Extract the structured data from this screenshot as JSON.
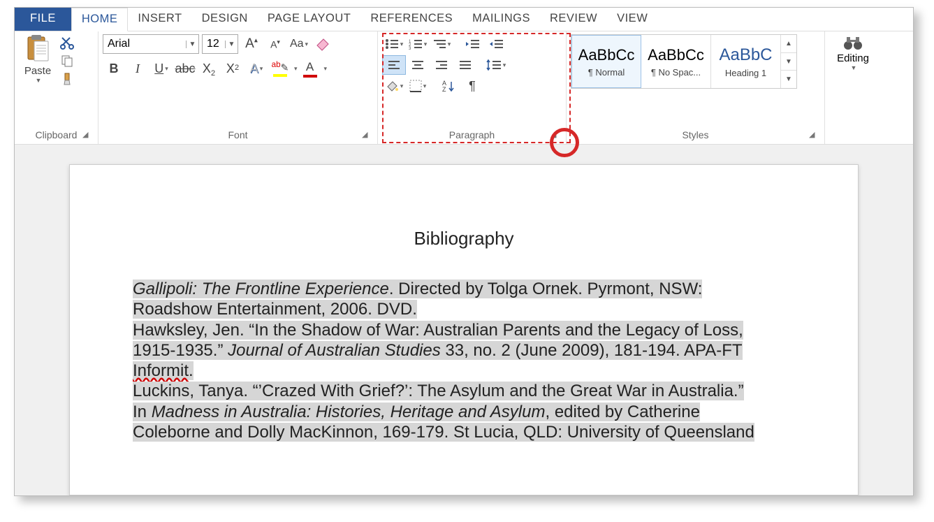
{
  "tabs": {
    "file": "FILE",
    "home": "HOME",
    "insert": "INSERT",
    "design": "DESIGN",
    "page_layout": "PAGE LAYOUT",
    "references": "REFERENCES",
    "mailings": "MAILINGS",
    "review": "REVIEW",
    "view": "VIEW"
  },
  "ribbon": {
    "clipboard": {
      "label": "Clipboard",
      "paste": "Paste"
    },
    "font": {
      "label": "Font",
      "name_value": "Arial",
      "size_value": "12"
    },
    "paragraph": {
      "label": "Paragraph"
    },
    "styles": {
      "label": "Styles",
      "items": [
        {
          "preview": "AaBbCc",
          "name": "¶ Normal"
        },
        {
          "preview": "AaBbCc",
          "name": "¶ No Spac..."
        },
        {
          "preview": "AaBbC",
          "name": "Heading 1"
        }
      ]
    },
    "editing": {
      "label": "Editing"
    }
  },
  "document": {
    "title": "Bibliography",
    "entries": {
      "e1a_it": "Gallipoli: The Frontline Experience",
      "e1b": ". Directed by Tolga Ornek. Pyrmont, NSW: ",
      "e1c": "Roadshow Entertainment, 2006. DVD.",
      "e2a": "Hawksley, Jen. “In the Shadow of War: Australian Parents and the Legacy of Loss, ",
      "e2b": "1915-1935.” ",
      "e2b_it": "Journal of Australian Studies",
      "e2c": " 33, no. 2 (June 2009), 181-194. APA-FT ",
      "e2d_err": "Informit",
      "e2e": ".",
      "e3a": "Luckins, Tanya. “’Crazed With Grief?’: The Asylum and the Great War in Australia.” ",
      "e3b": "In ",
      "e3b_it": "Madness in Australia: Histories, Heritage and Asylum",
      "e3c": ", edited by Catherine ",
      "e3d": "Coleborne and Dolly MacKinnon, 169-179. St Lucia, QLD: University of Queensland "
    }
  }
}
